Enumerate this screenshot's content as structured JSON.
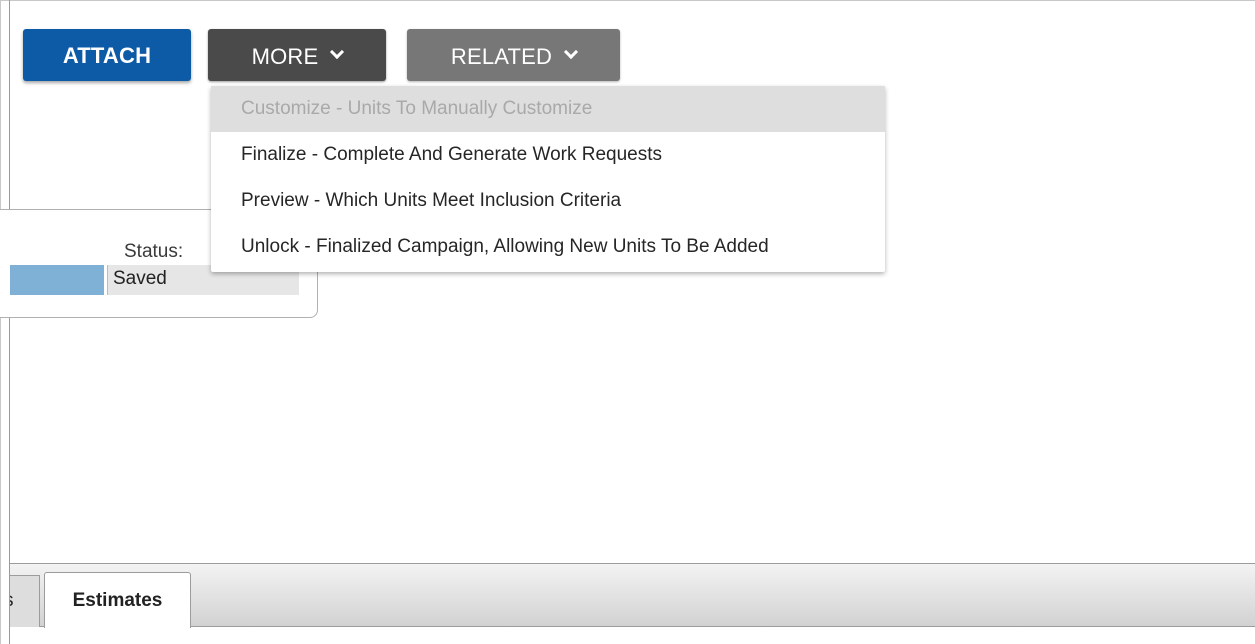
{
  "toolbar": {
    "attach_label": "ATTACH",
    "more_label": "MORE",
    "related_label": "RELATED"
  },
  "more_menu": {
    "items": [
      {
        "label": "Customize - Units To Manually Customize",
        "disabled": true
      },
      {
        "label": "Finalize - Complete And Generate Work Requests",
        "disabled": false
      },
      {
        "label": "Preview - Which Units Meet Inclusion Criteria",
        "disabled": false
      },
      {
        "label": "Unlock - Finalized Campaign, Allowing New Units To Be Added",
        "disabled": false
      }
    ]
  },
  "status": {
    "label": "Status:",
    "value": "Saved"
  },
  "tabs": {
    "partial_tab_label": "s",
    "active_tab_label": "Estimates"
  },
  "colors": {
    "attach_bg": "#0d5ba6",
    "more_bg": "#4a4a4a",
    "related_bg": "#777777",
    "highlight_field": "#7fb0d6"
  },
  "icons": {
    "more_chevron": "chevron-down-icon",
    "related_chevron": "chevron-down-icon"
  }
}
